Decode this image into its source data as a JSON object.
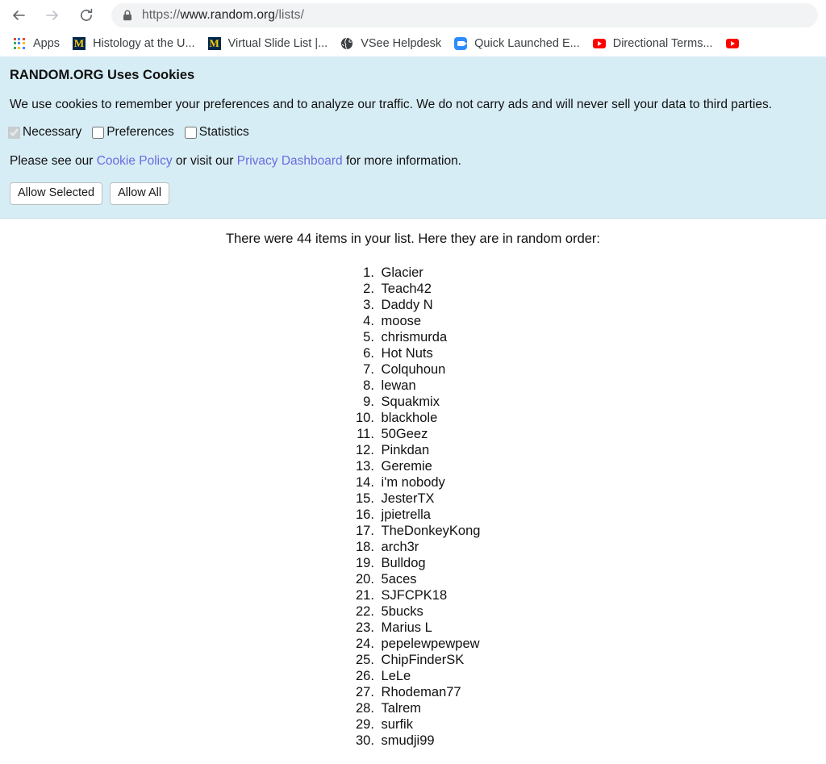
{
  "browser": {
    "back_icon": "back-arrow-icon",
    "forward_icon": "forward-arrow-icon",
    "reload_icon": "reload-icon",
    "lock_icon": "lock-icon",
    "url_scheme": "https://",
    "url_host": "www.random.org",
    "url_path": "/lists/",
    "url_full": "https://www.random.org/lists/"
  },
  "bookmarks": {
    "apps_label": "Apps",
    "items": [
      {
        "label": "Histology at the U...",
        "icon": "michigan-m-icon",
        "color": "#00274c"
      },
      {
        "label": "Virtual Slide List |...",
        "icon": "michigan-m-icon",
        "color": "#00274c"
      },
      {
        "label": "VSee Helpdesk",
        "icon": "globe-icon",
        "color": "#3c4043"
      },
      {
        "label": "Quick Launched E...",
        "icon": "zoom-camera-icon",
        "color": "#2d8cff"
      },
      {
        "label": "Directional Terms...",
        "icon": "youtube-icon",
        "color": "#ff0000"
      },
      {
        "label": "",
        "icon": "youtube-icon",
        "color": "#ff0000"
      }
    ]
  },
  "cookie_banner": {
    "background": "#d7edf5",
    "title": "RANDOM.ORG Uses Cookies",
    "body": "We use cookies to remember your preferences and to analyze our traffic. We do not carry ads and will never sell your data to third parties.",
    "choices": [
      {
        "label": "Necessary",
        "checked": true,
        "disabled": true
      },
      {
        "label": "Preferences",
        "checked": false,
        "disabled": false
      },
      {
        "label": "Statistics",
        "checked": false,
        "disabled": false
      }
    ],
    "policy_prefix": "Please see our ",
    "policy_link": "Cookie Policy",
    "policy_middle": " or visit our ",
    "dashboard_link": "Privacy Dashboard",
    "policy_suffix": " for more information.",
    "link_color": "#6a6ae0",
    "allow_selected_label": "Allow Selected",
    "allow_all_label": "Allow All"
  },
  "results": {
    "intro": "There were 44 items in your list. Here they are in random order:",
    "item_count": 44,
    "items": [
      "Glacier",
      "Teach42",
      "Daddy N",
      "moose",
      "chrismurda",
      "Hot Nuts",
      "Colquhoun",
      "lewan",
      "Squakmix",
      "blackhole",
      "50Geez",
      "Pinkdan",
      "Geremie",
      "i'm nobody",
      "JesterTX",
      "jpietrella",
      "TheDonkeyKong",
      "arch3r",
      "Bulldog",
      "5aces",
      "SJFCPK18",
      "5bucks",
      "Marius L",
      "pepelewpewpew",
      "ChipFinderSK",
      "LeLe",
      "Rhodeman77",
      "Talrem",
      "surfik",
      "smudji99"
    ]
  }
}
